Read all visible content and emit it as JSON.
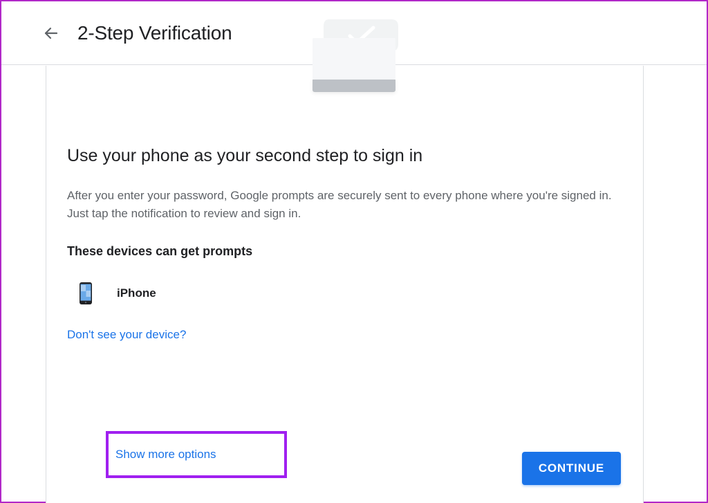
{
  "header": {
    "title": "2-Step Verification"
  },
  "main": {
    "heading": "Use your phone as your second step to sign in",
    "description": "After you enter your password, Google prompts are securely sent to every phone where you're signed in. Just tap the notification to review and sign in.",
    "devices_label": "These devices can get prompts",
    "devices": [
      {
        "name": "iPhone"
      }
    ],
    "link_no_device": "Don't see your device?",
    "link_more_options": "Show more options",
    "continue_label": "CONTINUE"
  },
  "colors": {
    "accent": "#1a73e8",
    "highlight": "#a020f0"
  }
}
